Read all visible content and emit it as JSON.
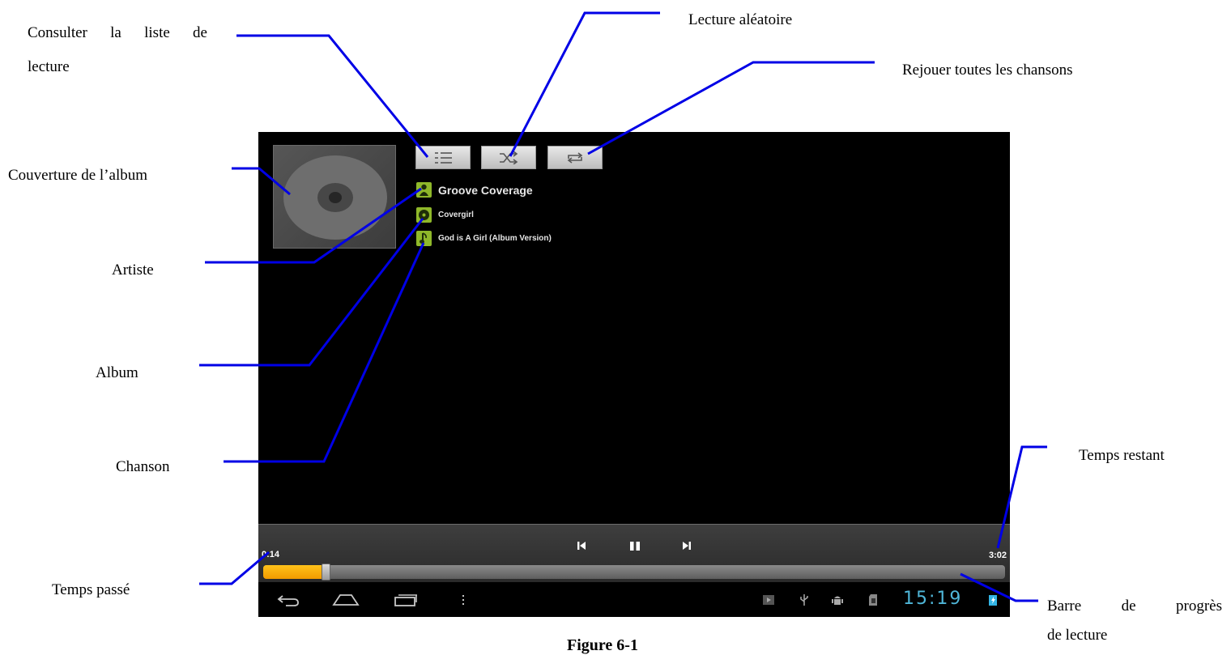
{
  "callouts": {
    "playlist_line1": "Consulter la liste de",
    "playlist_line2": "lecture",
    "shuffle": "Lecture aléatoire",
    "repeat": "Rejouer toutes les chansons",
    "album_cover": "Couverture de l’album",
    "artist": "Artiste",
    "album": "Album",
    "song": "Chanson",
    "time_remaining": "Temps restant",
    "time_elapsed": "Temps passé",
    "progress_line1": "Barre de progrès",
    "progress_line2": "de lecture"
  },
  "player": {
    "artist": "Groove Coverage",
    "album": "Covergirl",
    "song": "God is A Girl (Album Version)",
    "elapsed": "0:14",
    "remaining": "3:02",
    "progress_fraction": 0.084,
    "buttons": [
      "playlist-icon",
      "shuffle-icon",
      "repeat-icon"
    ],
    "transport": [
      "previous-icon",
      "pause-icon",
      "next-icon"
    ]
  },
  "system_bar": {
    "clock": "15:19",
    "nav_icons": [
      "back-icon",
      "home-icon",
      "recent-apps-icon",
      "menu-icon"
    ],
    "status_icons": [
      "media-play-icon",
      "usb-icon",
      "android-debug-icon",
      "sd-card-icon",
      "battery-charging-icon"
    ]
  },
  "colors": {
    "annotation_line": "#0000e6",
    "progress_fill": "#f7a800",
    "clock": "#4fb6d8",
    "info_icon": "#8fb82a"
  },
  "caption": "Figure 6-1"
}
